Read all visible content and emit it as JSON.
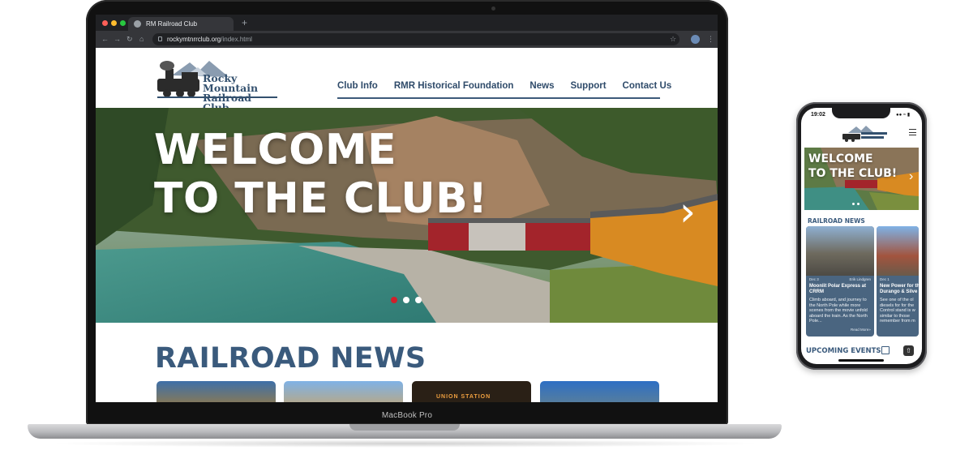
{
  "laptop": {
    "model_label": "MacBook Pro",
    "browser": {
      "tab_title": "RM Railroad Club",
      "url_host": "rockymtnrrclub.org",
      "url_path": "/index.html"
    }
  },
  "site": {
    "logo_line1": "Rocky Mountain",
    "logo_line2": "Railroad Club",
    "nav": [
      "Club Info",
      "RMR Historical Foundation",
      "News",
      "Support",
      "Contact Us"
    ],
    "hero": {
      "line1": "WELCOME",
      "line2": "TO THE CLUB!",
      "slides": 3,
      "active_slide": 1
    },
    "section_title": "RAILROAD NEWS",
    "card_label_3": "UNION STATION"
  },
  "phone": {
    "time": "19:02",
    "hero_line1": "WELCOME",
    "hero_line2": "TO THE CLUB!",
    "news_title": "RAILROAD NEWS",
    "cards": [
      {
        "date": "Dec 3",
        "author": "Erik Lindgren",
        "title": "Moonlit Polar Express at CRRM",
        "text": "Climb aboard, and journey to the North Pole while more scenes from the movie unfold aboard the train. As the North Pole...",
        "more": "Read More»"
      },
      {
        "date": "Dec 1",
        "title": "New Power for the Durango & Silve",
        "text": "See one of the ol diesels for for the Control stand is w similar to those remember from m"
      }
    ],
    "events_title": "UPCOMING EVENTS"
  },
  "colors": {
    "brand_blue": "#33506e",
    "active_dot": "#d0202a",
    "card_blue": "#4a6580"
  }
}
